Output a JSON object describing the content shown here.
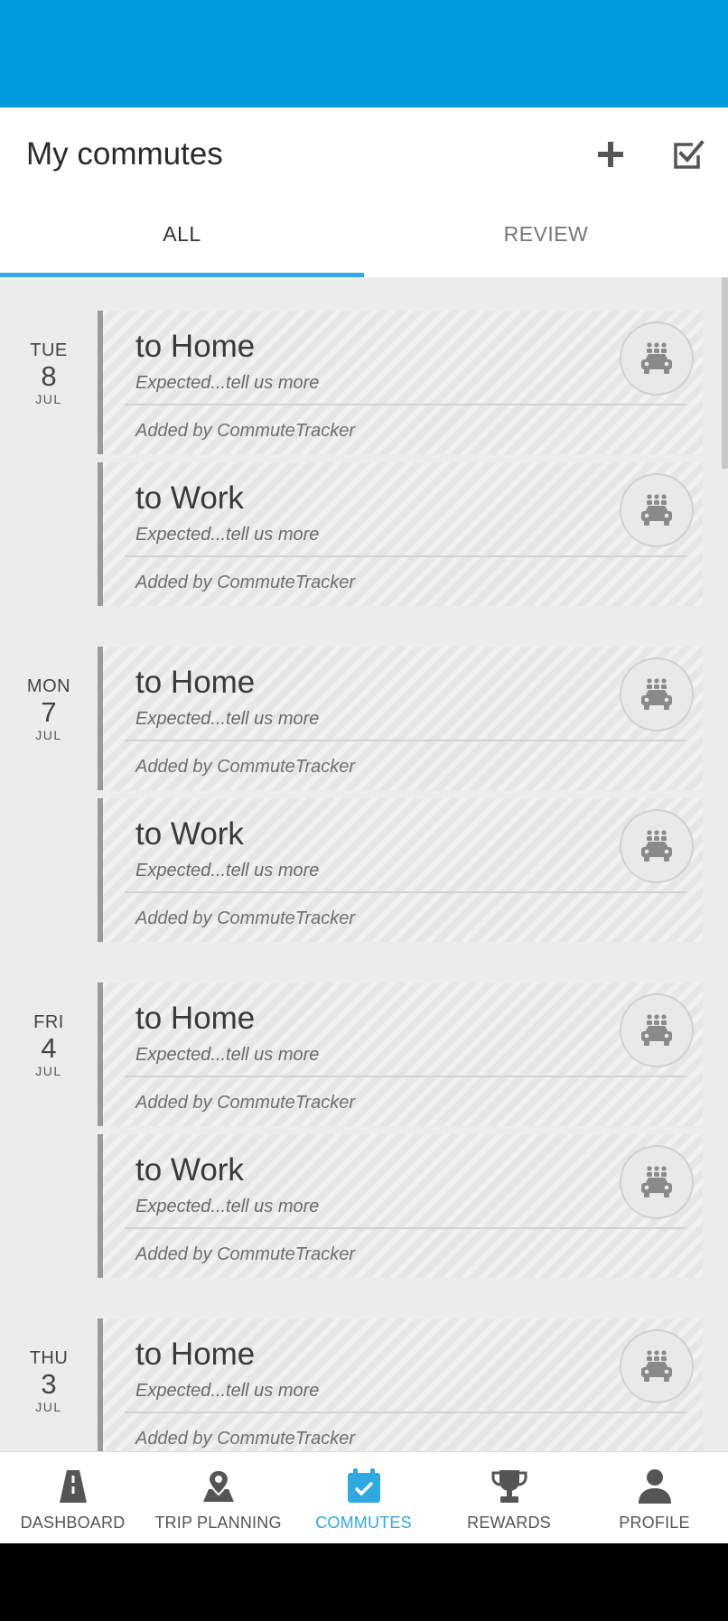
{
  "header": {
    "title": "My commutes",
    "add_icon": "plus-icon",
    "review_icon": "checkbox-icon"
  },
  "tabs": [
    {
      "label": "ALL",
      "active": true
    },
    {
      "label": "REVIEW",
      "active": false
    }
  ],
  "days": [
    {
      "dow": "TUE",
      "day": "8",
      "month": "JUL",
      "commutes": [
        {
          "title": "to Home",
          "subtitle": "Expected...tell us more",
          "added_by": "Added by CommuteTracker",
          "icon": "carpool-icon"
        },
        {
          "title": "to Work",
          "subtitle": "Expected...tell us more",
          "added_by": "Added by CommuteTracker",
          "icon": "carpool-icon"
        }
      ]
    },
    {
      "dow": "MON",
      "day": "7",
      "month": "JUL",
      "commutes": [
        {
          "title": "to Home",
          "subtitle": "Expected...tell us more",
          "added_by": "Added by CommuteTracker",
          "icon": "carpool-icon"
        },
        {
          "title": "to Work",
          "subtitle": "Expected...tell us more",
          "added_by": "Added by CommuteTracker",
          "icon": "carpool-icon"
        }
      ]
    },
    {
      "dow": "FRI",
      "day": "4",
      "month": "JUL",
      "commutes": [
        {
          "title": "to Home",
          "subtitle": "Expected...tell us more",
          "added_by": "Added by CommuteTracker",
          "icon": "carpool-icon"
        },
        {
          "title": "to Work",
          "subtitle": "Expected...tell us more",
          "added_by": "Added by CommuteTracker",
          "icon": "carpool-icon"
        }
      ]
    },
    {
      "dow": "THU",
      "day": "3",
      "month": "JUL",
      "commutes": [
        {
          "title": "to Home",
          "subtitle": "Expected...tell us more",
          "added_by": "Added by CommuteTracker",
          "icon": "carpool-icon"
        }
      ]
    }
  ],
  "nav": [
    {
      "label": "DASHBOARD",
      "icon": "road-icon",
      "active": false
    },
    {
      "label": "TRIP PLANNING",
      "icon": "map-pin-icon",
      "active": false
    },
    {
      "label": "COMMUTES",
      "icon": "calendar-check-icon",
      "active": true
    },
    {
      "label": "REWARDS",
      "icon": "trophy-icon",
      "active": false
    },
    {
      "label": "PROFILE",
      "icon": "person-icon",
      "active": false
    }
  ],
  "colors": {
    "brand": "#0099da",
    "accent": "#30a8e2",
    "card_border": "#9a9a9a"
  }
}
